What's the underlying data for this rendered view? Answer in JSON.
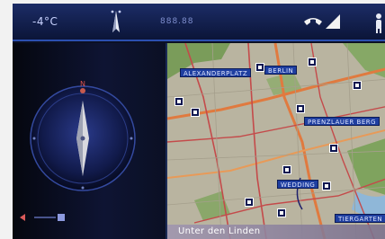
{
  "status_bar": {
    "temperature": "-4°C",
    "frequency": "888.88",
    "icons": [
      "compass-icon",
      "phone-icon",
      "signal-icon",
      "person-icon"
    ]
  },
  "compass": {
    "north_label": "N",
    "scale_label": "— B"
  },
  "map": {
    "labels": [
      "ALEXANDERPLATZ",
      "BERLIN",
      "PRENZLAUER BERG",
      "WEDDING",
      "TIERGARTEN"
    ],
    "street_label": "Unter den Linden"
  },
  "colors": {
    "accent": "#2b4fb0",
    "poi": "#0d1650",
    "route": "#e07a3f"
  }
}
